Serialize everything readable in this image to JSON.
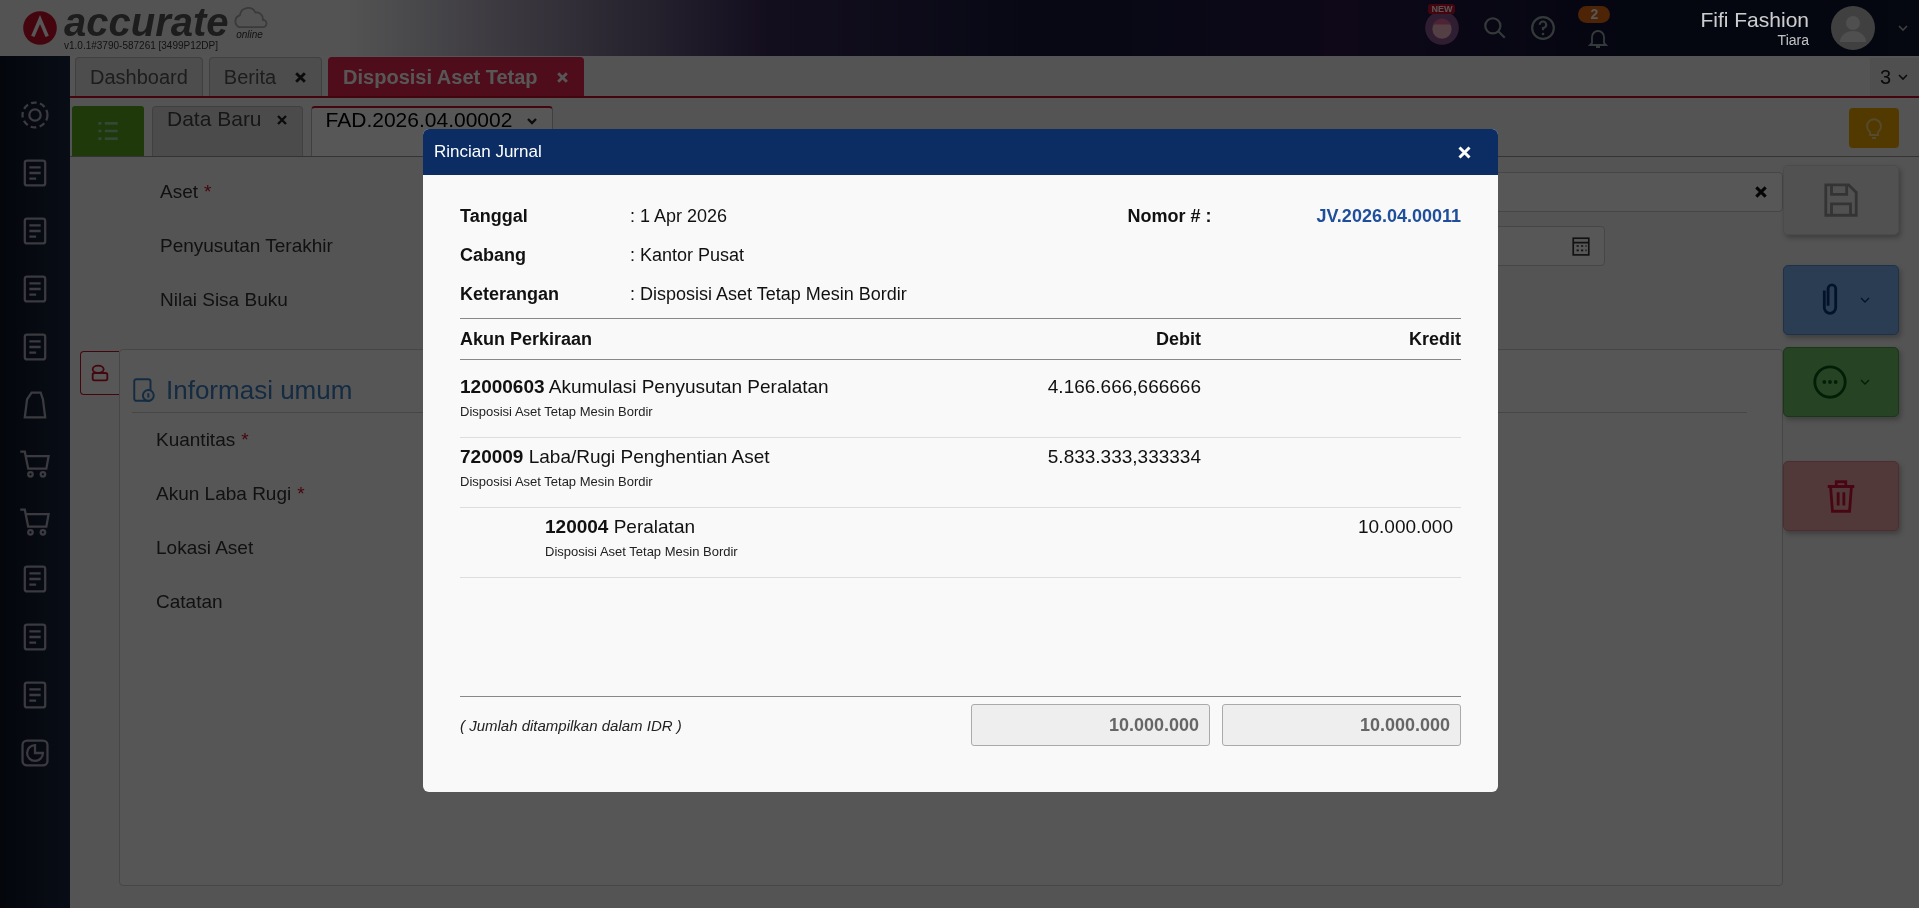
{
  "header": {
    "logo": "accurate",
    "logo_sub": "online",
    "version": "v1.0.1#3790-587261 [3499P12DP]",
    "new_badge": "NEW",
    "notification_count": "2",
    "company": "Fifi Fashion",
    "user": "Tiara"
  },
  "tabs": [
    {
      "label": "Dashboard",
      "selected": false,
      "closable": false
    },
    {
      "label": "Berita",
      "selected": false,
      "closable": true
    },
    {
      "label": "Disposisi Aset Tetap",
      "selected": true,
      "closable": true
    }
  ],
  "tab_count": "3",
  "subtabs": [
    {
      "label": "Data Baru",
      "selected": false,
      "kind": "closable"
    },
    {
      "label": "FAD.2026.04.00002",
      "selected": true,
      "kind": "dropdown"
    }
  ],
  "form": {
    "required_mark": "*",
    "top_fields": [
      {
        "label": "Aset",
        "required": true,
        "kind": "clearable"
      },
      {
        "label": "Penyusutan Terakhir",
        "required": false,
        "kind": "date"
      },
      {
        "label": "Nilai Sisa Buku",
        "required": false,
        "kind": "plain"
      }
    ],
    "section_title": "Informasi umum",
    "section_fields": [
      {
        "label": "Kuantitas",
        "required": true
      },
      {
        "label": "Akun Laba Rugi",
        "required": true
      },
      {
        "label": "Lokasi Aset",
        "required": false
      },
      {
        "label": "Catatan",
        "required": false
      }
    ]
  },
  "modal": {
    "title": "Rincian Jurnal",
    "info": [
      {
        "label": "Tanggal",
        "value": ": 1 Apr 2026"
      },
      {
        "label": "Cabang",
        "value": ": Kantor Pusat"
      },
      {
        "label": "Keterangan",
        "value": ": Disposisi Aset Tetap Mesin Bordir"
      }
    ],
    "number_label": "Nomor # :",
    "number": "JV.2026.04.00011",
    "columns": [
      "Akun Perkiraan",
      "Debit",
      "Kredit"
    ],
    "rows": [
      {
        "account": "**12000603** Akumulasi Penyusutan Peralatan",
        "memo": "Disposisi Aset Tetap Mesin Bordir",
        "debit": "4.166.666,666666",
        "indented": false
      },
      {
        "account": "**720009** Laba/Rugi Penghentian Aset",
        "memo": "Disposisi Aset Tetap Mesin Bordir",
        "debit": "5.833.333,333334",
        "indented": false
      },
      {
        "account": "**120004** Peralatan",
        "memo": "Disposisi Aset Tetap Mesin Bordir",
        "credit": "10.000.000",
        "indented": true
      }
    ],
    "note": "( Jumlah ditampilkan dalam IDR )",
    "total_debit": "10.000.000",
    "total_credit": "10.000.000"
  }
}
